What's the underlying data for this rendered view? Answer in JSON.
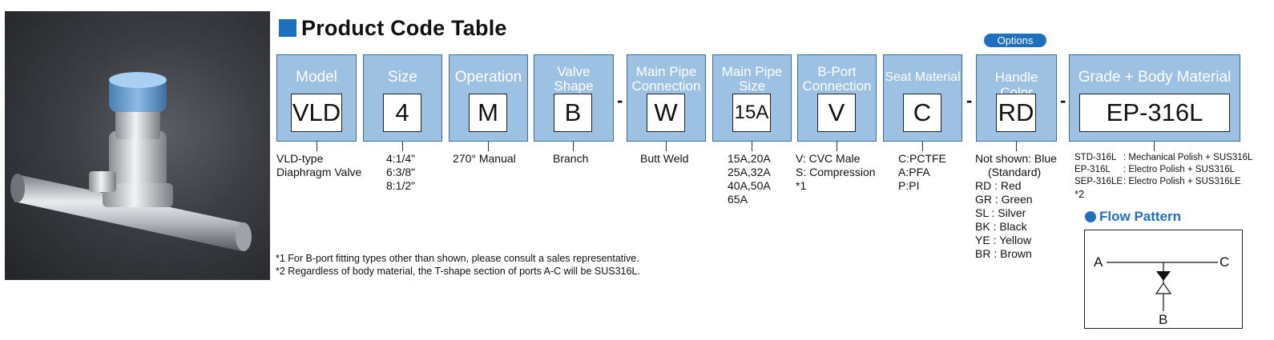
{
  "title": "Product Code Table",
  "options_label": "Options",
  "segments": [
    {
      "label": "Model",
      "code": "VLD",
      "desc": [
        "VLD-type",
        "Diaphragm Valve"
      ]
    },
    {
      "label": "Size",
      "code": "4",
      "desc": [
        "4:1/4\"",
        "6:3/8\"",
        "8:1/2\""
      ]
    },
    {
      "label": "Operation",
      "code": "M",
      "desc": [
        "270° Manual"
      ]
    },
    {
      "label_lines": [
        "Valve",
        "Shape"
      ],
      "code": "B",
      "desc": [
        "Branch"
      ]
    },
    {
      "label_lines": [
        "Main Pipe",
        "Connection"
      ],
      "code": "W",
      "desc": [
        "Butt Weld"
      ]
    },
    {
      "label_lines": [
        "Main Pipe",
        "Size"
      ],
      "code": "15A",
      "desc": [
        "15A,20A",
        "25A,32A",
        "40A,50A",
        "65A"
      ]
    },
    {
      "label_lines": [
        "B-Port",
        "Connection"
      ],
      "code": "V",
      "desc": [
        "V: CVC Male",
        "S: Compression",
        "*1"
      ]
    },
    {
      "label": "Seat Material",
      "code": "C",
      "desc": [
        "C:PCTFE",
        "A:PFA",
        "P:PI"
      ]
    },
    {
      "label": "Handle Color",
      "code": "RD",
      "desc": [
        "Not shown: Blue",
        "(Standard)",
        "RD : Red",
        "GR : Green",
        "SL : Silver",
        "BK : Black",
        "YE : Yellow",
        "BR : Brown"
      ]
    },
    {
      "label": "Grade + Body Material",
      "code": "EP-316L"
    }
  ],
  "separator": "-",
  "grade_materials": [
    {
      "code": "STD-316L",
      "desc": ": Mechanical Polish + SUS316L"
    },
    {
      "code": "EP-316L",
      "desc": ": Electro Polish + SUS316L"
    },
    {
      "code": "SEP-316LE",
      "desc": ": Electro Polish + SUS316LE"
    }
  ],
  "grade_note": "*2",
  "flow_pattern": {
    "title": "Flow Pattern",
    "port_a": "A",
    "port_b": "B",
    "port_c": "C"
  },
  "notes": [
    "*1 For B-port fitting types other than shown, please consult a sales representative.",
    "*2 Regardless of body material, the T-shape section of ports A-C will be SUS316L."
  ],
  "colors": {
    "accent": "#1f6fc0",
    "segment_fill": "#9dc1e3",
    "segment_border": "#3c6e98"
  },
  "photo": {
    "icon": "diaphragm-valve-photo"
  }
}
